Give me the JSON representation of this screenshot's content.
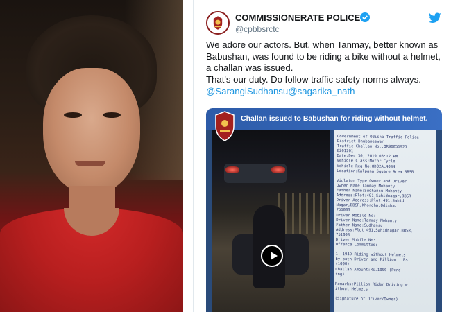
{
  "photo": {
    "icon": "portrait-photo"
  },
  "tweet": {
    "author_name": "COMMISSIONERATE POLICE",
    "handle": "@cpbbsrctc",
    "verified_icon": "verified-badge-icon",
    "bird_icon": "twitter-bird-icon",
    "body_lines": [
      "We adore our actors. But, when Tanmay, better known as",
      "Babushan, was found to be riding a bike without a helmet,",
      "a challan was issued.",
      "That's our duty. Do follow traffic safety norms always."
    ],
    "mentions": [
      "@SarangiSudhansu",
      "@sagarika_nath"
    ],
    "media": {
      "title": "Challan issued to Babushan for riding without helmet.",
      "play_icon": "play-icon",
      "receipt_lines": [
        "Government of Odisha Traffic Police",
        "District:Bhubaneswar",
        "Traffic Challan No.:OR96051921",
        "8201201",
        "Date:Dec 30, 2019 08:12 PM",
        "Vehicle Class:Motor Cycle",
        "Vehicle Reg No:OD02AL4044",
        "Location:Kalpana Square Area BBSR",
        "",
        "Violator Type:Owner and Driver",
        "Owner Name:Tanmay Mohanty",
        "Father Name:Sudhansu Mohanty",
        "Address:Plot:491,Sahidnagar,BBSR",
        "Driver Address:Plot:491,Sahid",
        "Nagar,BBSR,Khordha,Odisha,",
        "751003",
        "Driver Mobile No:",
        "Driver Name:Tanmay Mohanty",
        "Father Name:Sudhansu",
        "Address:Plot 491,Sahidnagar,BBSR,",
        "751003",
        "Driver Mobile No:",
        "Offence Committed:",
        "",
        "1. 194D Riding without Helmets",
        "by both Driver and Pillion   Rs",
        "(1000)",
        "Challan Amount:Rs.1000 (Pend",
        "ing)",
        "",
        "Remarks:Pillion Rider Driving w",
        "ithout Helmets",
        "",
        "(Signature of Driver/Owner)"
      ]
    }
  },
  "colors": {
    "link": "#1b95e0",
    "twitter_blue": "#1da1f2",
    "banner": "#2d5ba8",
    "shirt": "#c62424"
  }
}
